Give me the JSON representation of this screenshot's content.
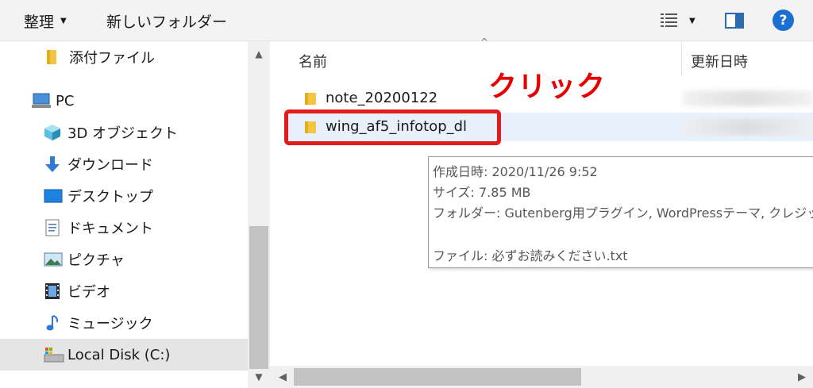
{
  "toolbar": {
    "organize_label": "整理",
    "new_folder_label": "新しいフォルダー",
    "view_icon": "details-view-icon",
    "pane_icon": "preview-pane-icon",
    "help_label": "?"
  },
  "sidebar": {
    "items": [
      {
        "label": "添付ファイル",
        "icon": "folder-icon"
      },
      {
        "label": "PC",
        "icon": "pc-icon"
      },
      {
        "label": "3D オブジェクト",
        "icon": "3d-objects-icon"
      },
      {
        "label": "ダウンロード",
        "icon": "download-icon"
      },
      {
        "label": "デスクトップ",
        "icon": "desktop-icon"
      },
      {
        "label": "ドキュメント",
        "icon": "documents-icon"
      },
      {
        "label": "ピクチャ",
        "icon": "pictures-icon"
      },
      {
        "label": "ビデオ",
        "icon": "videos-icon"
      },
      {
        "label": "ミュージック",
        "icon": "music-icon"
      },
      {
        "label": "Local Disk (C:)",
        "icon": "local-disk-icon",
        "selected": true
      }
    ]
  },
  "main": {
    "columns": {
      "name": "名前",
      "date_modified": "更新日時"
    },
    "rows": [
      {
        "name": "note_20200122"
      },
      {
        "name": "wing_af5_infotop_dl"
      }
    ],
    "annotation": "クリック",
    "tooltip": {
      "created": "作成日時: 2020/11/26 9:52",
      "size": "サイズ: 7.85 MB",
      "folders": "フォルダー: Gutenberg用プラグイン, WordPressテーマ, クレジット",
      "files": "ファイル: 必ずお読みください.txt"
    }
  },
  "colors": {
    "highlight": "#e11d1d",
    "annotation": "#e60000",
    "selection": "#e5e5e5",
    "hover": "#e8f1fb",
    "accent": "#1a6fd1"
  }
}
